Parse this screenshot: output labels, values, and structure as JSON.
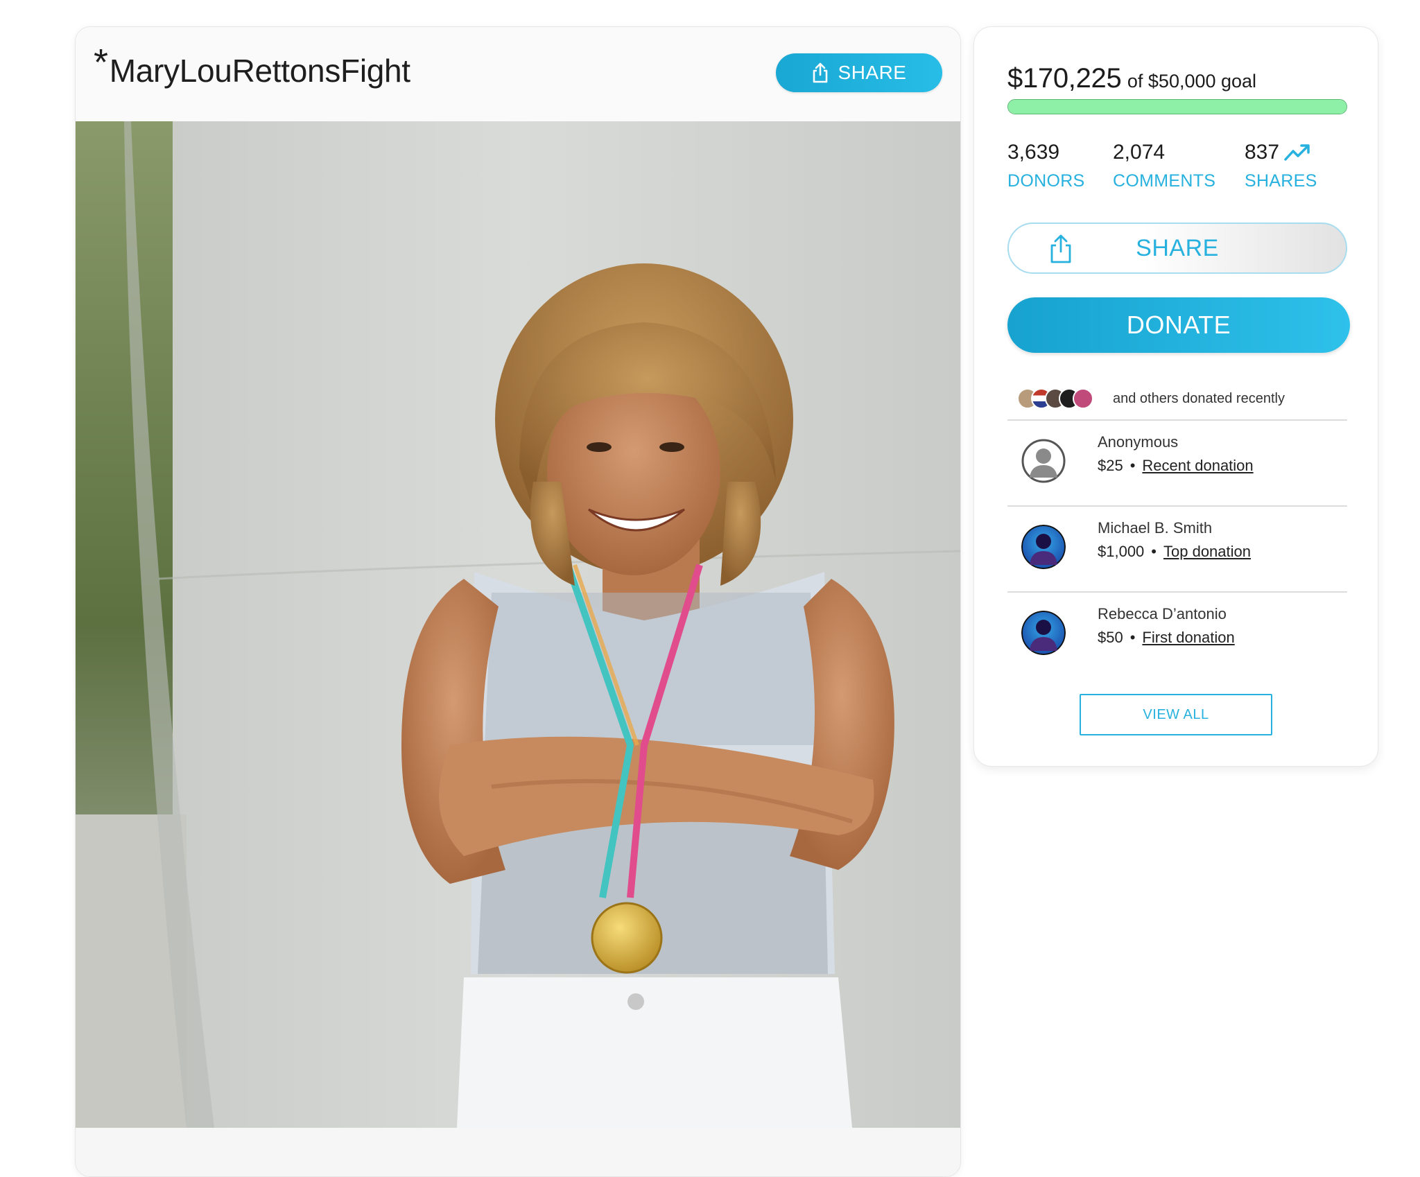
{
  "campaign": {
    "asterisk": "*",
    "title": "MaryLouRettonsFight",
    "share_label": "SHARE",
    "photo_alt": "share-icon"
  },
  "sidebar": {
    "raised_amount": "$170,225",
    "goal_text": "of $50,000 goal",
    "progress_fraction": 1.0,
    "stats": [
      {
        "value": "3,639",
        "label": "DONORS"
      },
      {
        "value": "2,074",
        "label": "COMMENTS"
      },
      {
        "value": "837",
        "label": "SHARES",
        "icon": "trending-up-icon"
      }
    ],
    "share_label": "SHARE",
    "donate_label": "DONATE",
    "recent_text": "and others donated recently",
    "donors": [
      {
        "name": "Anonymous",
        "amount": "$25",
        "tag": "Recent donation",
        "avatar": "default-avatar-icon"
      },
      {
        "name": "Michael B. Smith",
        "amount": "$1,000",
        "tag": "Top donation",
        "avatar": "user-silhouette-icon"
      },
      {
        "name": "Rebecca D’antonio",
        "amount": "$50",
        "tag": "First donation",
        "avatar": "user-silhouette-icon"
      }
    ],
    "view_all_label": "VIEW ALL"
  },
  "colors": {
    "accent": "#27b1de",
    "progress": "#8ef0a6",
    "title": "#1e1e1e"
  }
}
